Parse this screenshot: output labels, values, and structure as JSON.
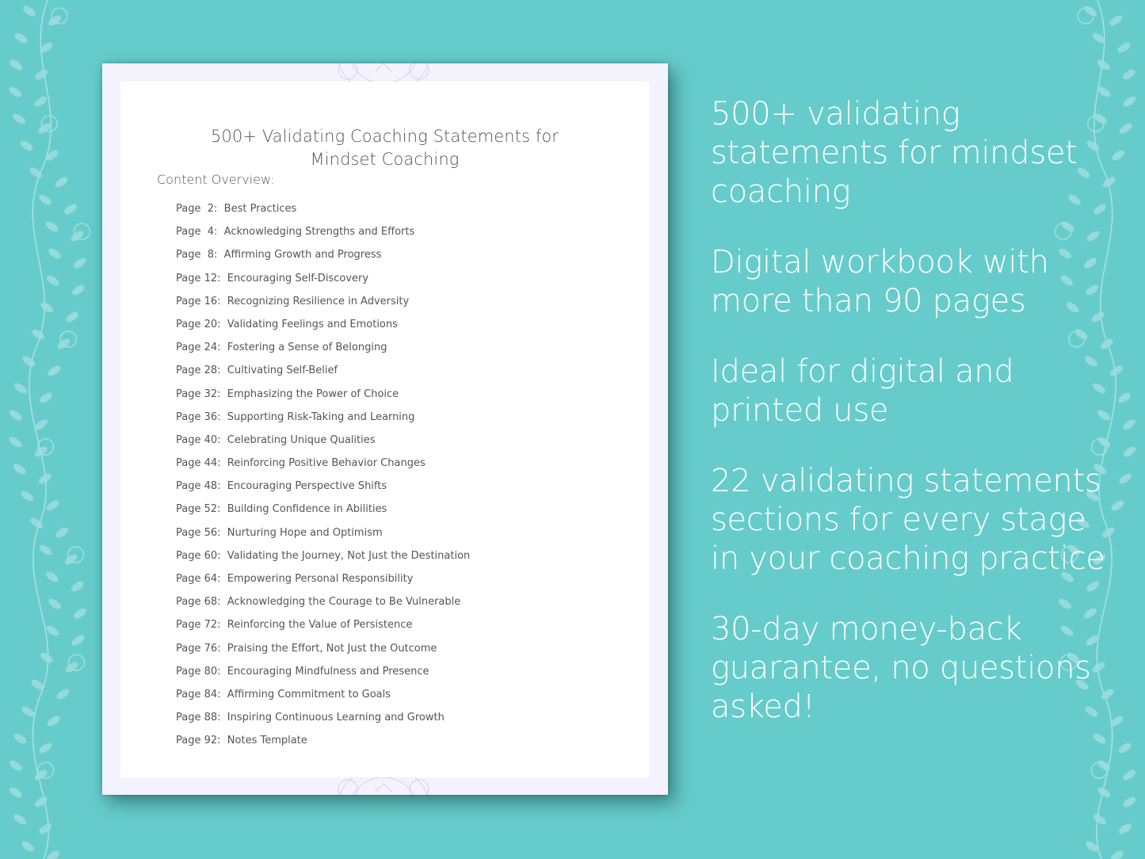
{
  "document": {
    "title_line1": "500+ Validating Coaching Statements for",
    "title_line2": "Mindset Coaching",
    "overview_label": "Content Overview:",
    "toc": [
      {
        "page": "Page  2:",
        "title": "Best Practices"
      },
      {
        "page": "Page  4:",
        "title": "Acknowledging Strengths and Efforts"
      },
      {
        "page": "Page  8:",
        "title": "Affirming Growth and Progress"
      },
      {
        "page": "Page 12:",
        "title": "Encouraging Self-Discovery"
      },
      {
        "page": "Page 16:",
        "title": "Recognizing Resilience in Adversity"
      },
      {
        "page": "Page 20:",
        "title": "Validating Feelings and Emotions"
      },
      {
        "page": "Page 24:",
        "title": "Fostering a Sense of Belonging"
      },
      {
        "page": "Page 28:",
        "title": "Cultivating Self-Belief"
      },
      {
        "page": "Page 32:",
        "title": "Emphasizing the Power of Choice"
      },
      {
        "page": "Page 36:",
        "title": "Supporting Risk-Taking and Learning"
      },
      {
        "page": "Page 40:",
        "title": "Celebrating Unique Qualities"
      },
      {
        "page": "Page 44:",
        "title": "Reinforcing Positive Behavior Changes"
      },
      {
        "page": "Page 48:",
        "title": "Encouraging Perspective Shifts"
      },
      {
        "page": "Page 52:",
        "title": "Building Confidence in Abilities"
      },
      {
        "page": "Page 56:",
        "title": "Nurturing Hope and Optimism"
      },
      {
        "page": "Page 60:",
        "title": "Validating the Journey, Not Just the Destination"
      },
      {
        "page": "Page 64:",
        "title": "Empowering Personal Responsibility"
      },
      {
        "page": "Page 68:",
        "title": "Acknowledging the Courage to Be Vulnerable"
      },
      {
        "page": "Page 72:",
        "title": "Reinforcing the Value of Persistence"
      },
      {
        "page": "Page 76:",
        "title": "Praising the Effort, Not Just the Outcome"
      },
      {
        "page": "Page 80:",
        "title": "Encouraging Mindfulness and Presence"
      },
      {
        "page": "Page 84:",
        "title": "Affirming Commitment to Goals"
      },
      {
        "page": "Page 88:",
        "title": "Inspiring Continuous Learning and Growth"
      },
      {
        "page": "Page 92:",
        "title": "Notes Template"
      }
    ]
  },
  "features": [
    "500+ validating statements for mindset coaching",
    "Digital workbook with more than 90 pages",
    "Ideal for digital and printed use",
    "22 validating statements sections for every stage in your coaching practice",
    "30-day money-back guarantee, no questions asked!"
  ],
  "colors": {
    "background": "#66cccb",
    "page_border": "#f4f2fd",
    "text_dark": "#555555",
    "feature_text": "#ffffff",
    "vine": "#a7e3e1"
  },
  "icons": {
    "left_decoration": "floral-vine-icon",
    "right_decoration": "floral-vine-icon",
    "page_decoration": "mandala-icon"
  }
}
